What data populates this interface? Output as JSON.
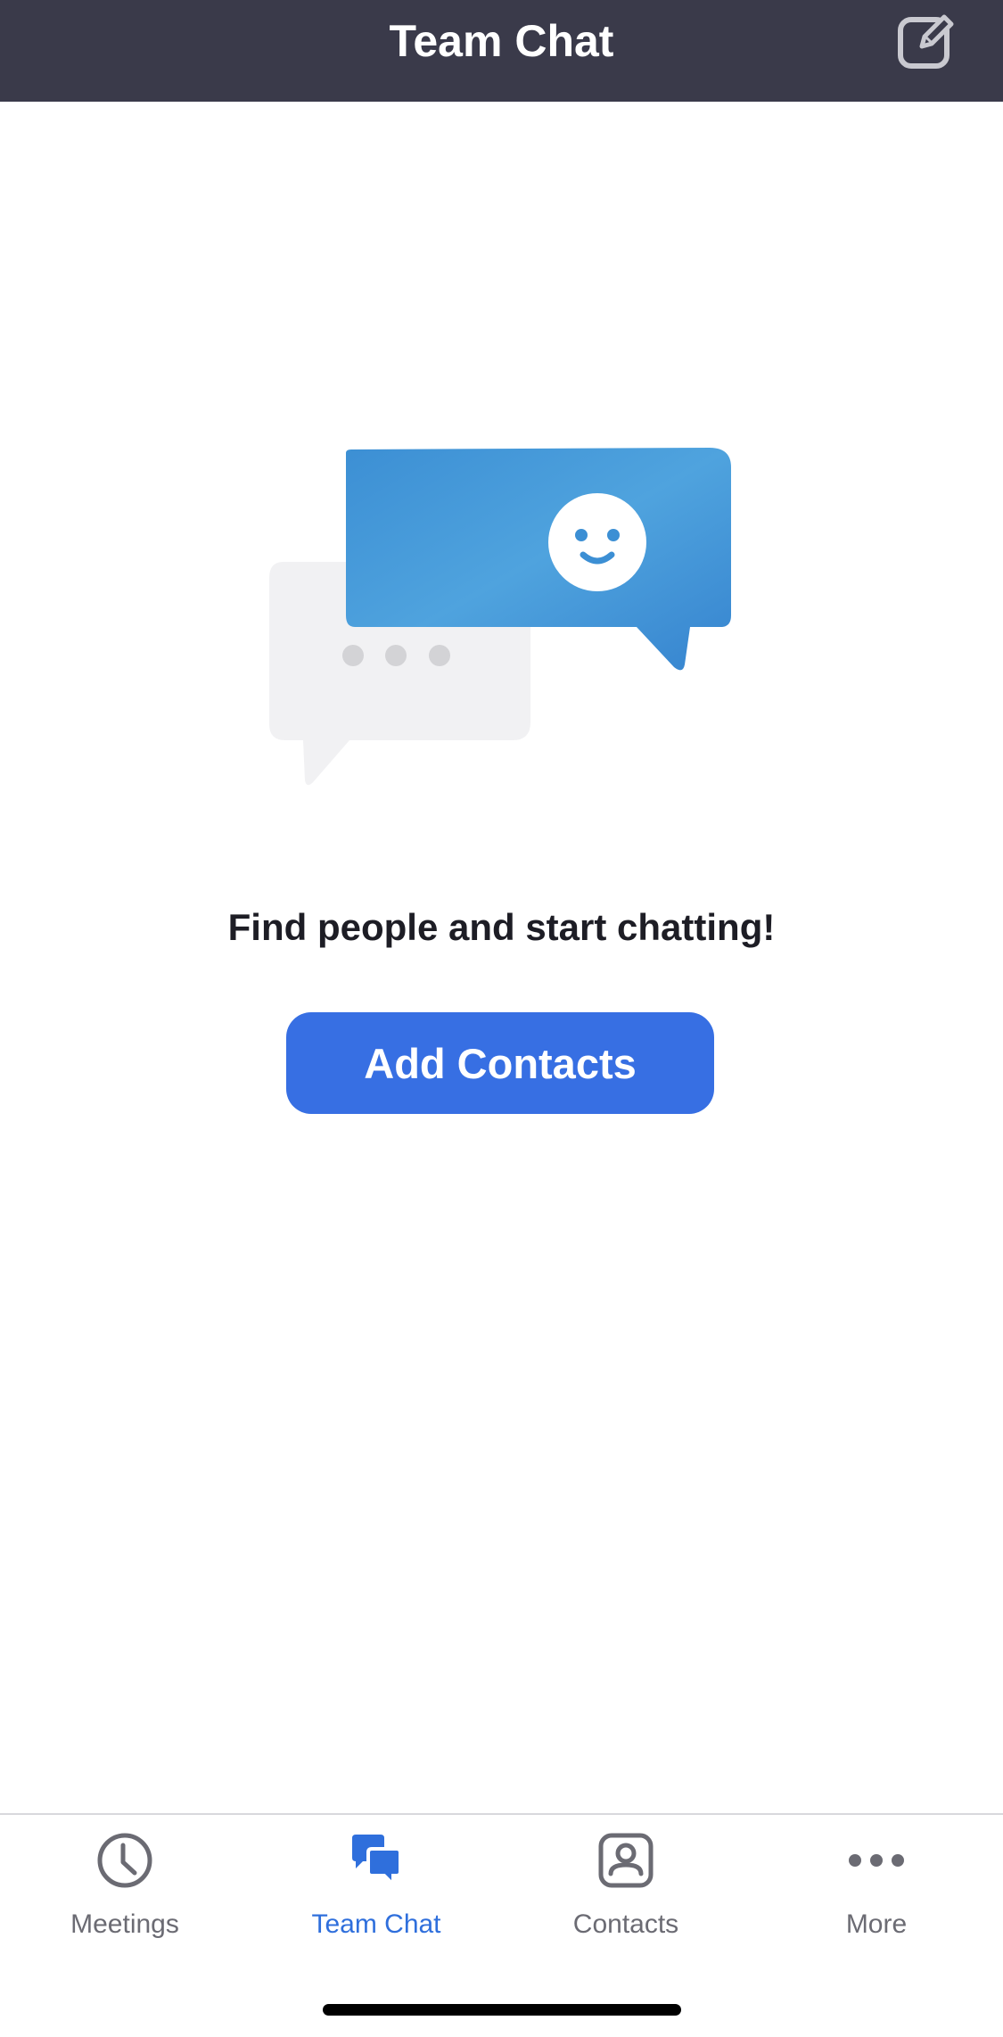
{
  "header": {
    "title": "Team Chat",
    "compose_icon": "compose-icon"
  },
  "illustration": {
    "left_bubble_icon": "typing-bubble-icon",
    "right_bubble_icon": "smiley-bubble-icon",
    "accent_color": "#3c8fd4"
  },
  "main": {
    "message": "Find people and start chatting!",
    "add_contacts_label": "Add Contacts"
  },
  "tabs": [
    {
      "label": "Meetings",
      "icon": "clock-icon",
      "active": false
    },
    {
      "label": "Team Chat",
      "icon": "chat-bubbles-icon",
      "active": true
    },
    {
      "label": "Contacts",
      "icon": "contact-card-icon",
      "active": false
    },
    {
      "label": "More",
      "icon": "more-dots-icon",
      "active": false
    }
  ],
  "colors": {
    "header_bg": "#3a3a4a",
    "primary": "#376fe3",
    "active_tab": "#2f6fdc",
    "inactive_tab": "#6b6b73"
  }
}
